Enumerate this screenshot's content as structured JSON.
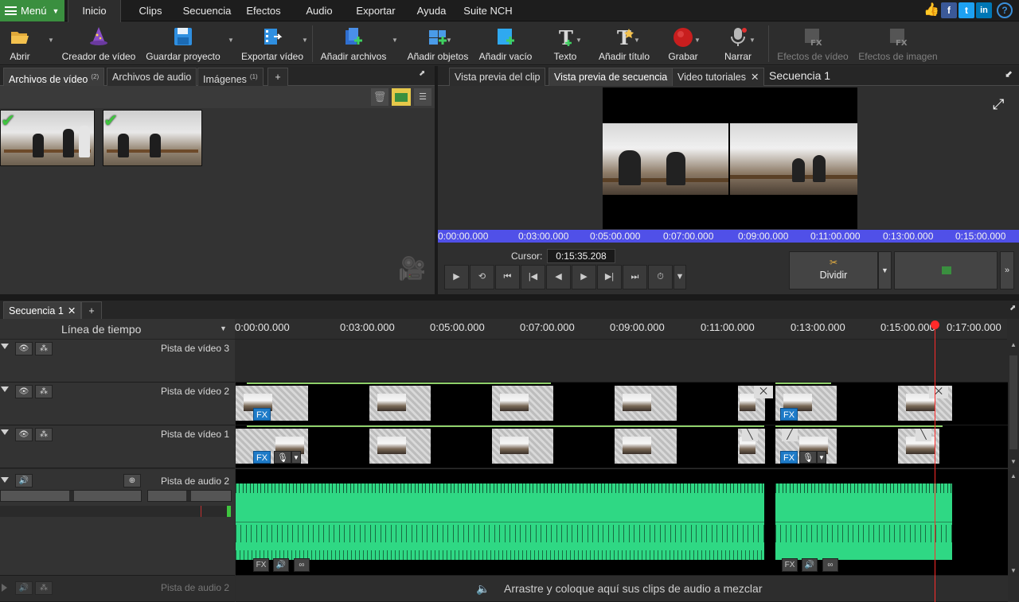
{
  "menubar": {
    "menu_label": "Menú",
    "tabs": [
      "Inicio",
      "Clips",
      "Secuencia",
      "Efectos",
      "Audio",
      "Exportar",
      "Ayuda",
      "Suite NCH"
    ],
    "active_tab": "Inicio"
  },
  "toolbar": {
    "items": [
      {
        "label": "Abrir",
        "icon": "folder-open-icon"
      },
      {
        "label": "Creador de vídeo",
        "icon": "wizard-hat-icon"
      },
      {
        "label": "Guardar proyecto",
        "icon": "floppy-disk-icon"
      },
      {
        "label": "Exportar vídeo",
        "icon": "export-film-icon"
      },
      {
        "label": "Añadir archivos",
        "icon": "add-files-icon"
      },
      {
        "label": "Añadir objetos",
        "icon": "add-objects-icon"
      },
      {
        "label": "Añadir vacío",
        "icon": "add-blank-icon"
      },
      {
        "label": "Texto",
        "icon": "text-icon"
      },
      {
        "label": "Añadir título",
        "icon": "add-title-icon"
      },
      {
        "label": "Grabar",
        "icon": "record-icon"
      },
      {
        "label": "Narrar",
        "icon": "microphone-icon"
      },
      {
        "label": "Efectos de vídeo",
        "icon": "video-fx-icon"
      },
      {
        "label": "Efectos de imagen",
        "icon": "image-fx-icon"
      }
    ]
  },
  "media_bin": {
    "tabs": [
      {
        "label": "Archivos de vídeo",
        "count": "(2)"
      },
      {
        "label": "Archivos de audio",
        "count": ""
      },
      {
        "label": "Imágenes",
        "count": "(1)"
      }
    ],
    "add_tab": "+"
  },
  "preview": {
    "tabs": [
      "Vista previa del clip",
      "Vista previa de secuencia",
      "Video tutoriales"
    ],
    "active_tab": "Vista previa de secuencia",
    "sequence_title": "Secuencia 1",
    "ruler_ticks": [
      "0:00:00.000",
      "0:03:00.000",
      "0:05:00.000",
      "0:07:00.000",
      "0:09:00.000",
      "0:11:00.000",
      "0:13:00.000",
      "0:15:00.000"
    ],
    "cursor_label": "Cursor:",
    "cursor_value": "0:15:35.208",
    "split_label": "Dividir"
  },
  "timeline": {
    "sequence_tab": "Secuencia 1",
    "header_label": "Línea de tiempo",
    "ruler_ticks": [
      "0:00:00.000",
      "0:03:00.000",
      "0:05:00.000",
      "0:07:00.000",
      "0:09:00.000",
      "0:11:00.000",
      "0:13:00.000",
      "0:15:00.000",
      "0:17:00.000"
    ],
    "tracks": [
      {
        "name": "Pista de vídeo 3"
      },
      {
        "name": "Pista de vídeo 2"
      },
      {
        "name": "Pista de vídeo 1"
      },
      {
        "name": "Pista de audio 2"
      }
    ],
    "empty_track_name": "Pista de audio 2",
    "drop_hint": "Arrastre y coloque aquí sus clips de audio a mezclar",
    "fx_label": "FX"
  },
  "colors": {
    "accent_green": "#3a8f3f",
    "ruler_blue": "#5050e8",
    "waveform": "#2fd884",
    "playhead": "#ff2a2a",
    "fx_blue": "#1e7bc8"
  }
}
